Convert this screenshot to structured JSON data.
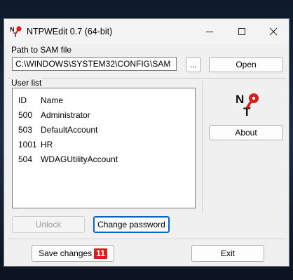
{
  "window": {
    "title": "NTPWEdit 0.7 (64-bit)"
  },
  "path": {
    "group_label": "Path to SAM file",
    "value": "C:\\WINDOWS\\SYSTEM32\\CONFIG\\SAM",
    "browse_label": "...",
    "open_label": "Open"
  },
  "users": {
    "group_label": "User list",
    "columns": [
      "ID",
      "Name"
    ],
    "rows": [
      {
        "id": "500",
        "name": "Administrator"
      },
      {
        "id": "503",
        "name": "DefaultAccount"
      },
      {
        "id": "1001",
        "name": "HR"
      },
      {
        "id": "504",
        "name": "WDAGUtilityAccount"
      }
    ]
  },
  "side": {
    "about_label": "About"
  },
  "actions": {
    "unlock_label": "Unlock",
    "change_password_label": "Change password",
    "save_label": "Save changes",
    "exit_label": "Exit"
  },
  "annotation": {
    "badge": "11"
  },
  "colors": {
    "badge": "#d6201e",
    "focus_border": "#0a63c8",
    "key_red": "#d6201e"
  }
}
